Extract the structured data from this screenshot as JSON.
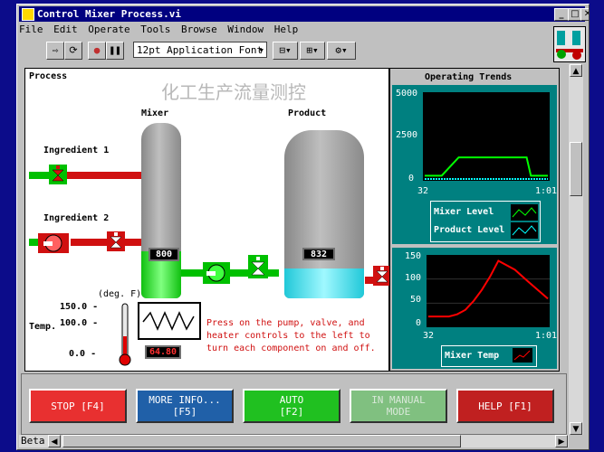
{
  "window": {
    "title": "Control Mixer Process.vi"
  },
  "menu": [
    "File",
    "Edit",
    "Operate",
    "Tools",
    "Browse",
    "Window",
    "Help"
  ],
  "toolbar": {
    "font": "12pt Application Font"
  },
  "process": {
    "title": "Process",
    "watermark": "化工生产流量测控",
    "mixer_label": "Mixer",
    "product_label": "Product",
    "ingredient1": "Ingredient 1",
    "ingredient2": "Ingredient 2",
    "mixer_display": "800",
    "product_display": "832",
    "mixer_level_fraction": 0.27,
    "product_level_fraction": 0.18,
    "temp_unit": "(deg. F)",
    "temp_label": "Temp.",
    "temp_ticks": [
      "150.0 -",
      "100.0 -",
      "0.0 -"
    ],
    "temp_value": "64.80",
    "instructions": [
      "Press on the pump, valve, and",
      "heater controls to the left to",
      "turn each component on and off."
    ]
  },
  "trends": {
    "title": "Operating Trends"
  },
  "chart_data": [
    {
      "type": "line",
      "y_ticks": [
        "5000",
        "2500",
        "0"
      ],
      "x_ticks": [
        "32",
        "1:01"
      ],
      "ylim": [
        0,
        5000
      ],
      "x": [
        32,
        36,
        40,
        46,
        56,
        57,
        61
      ],
      "series": [
        {
          "name": "Mixer Level",
          "color": "#00ff00",
          "values": [
            200,
            200,
            1300,
            1300,
            1300,
            200,
            200
          ]
        },
        {
          "name": "Product Level",
          "color": "#00ffff",
          "values": [
            0,
            0,
            0,
            0,
            0,
            0,
            0
          ]
        }
      ]
    },
    {
      "type": "line",
      "y_ticks": [
        "150",
        "100",
        "50",
        "0"
      ],
      "x_ticks": [
        "32",
        "1:01"
      ],
      "ylim": [
        0,
        150
      ],
      "x": [
        32,
        37,
        39,
        41,
        43,
        45,
        47,
        49,
        53,
        56,
        61
      ],
      "series": [
        {
          "name": "Mixer Temp",
          "color": "#ff0000",
          "values": [
            20,
            20,
            25,
            35,
            55,
            80,
            110,
            145,
            125,
            100,
            60
          ]
        }
      ]
    }
  ],
  "buttons": [
    {
      "label": "STOP [F4]",
      "color": "#e83030"
    },
    {
      "label": "MORE INFO...\n[F5]",
      "color": "#2060a8"
    },
    {
      "label": "AUTO\n[F2]",
      "color": "#20c020"
    },
    {
      "label": "IN MANUAL\nMODE",
      "color": "#80c080"
    },
    {
      "label": "HELP [F1]",
      "color": "#c02020"
    }
  ],
  "status": {
    "scroll_label": "Beta"
  }
}
